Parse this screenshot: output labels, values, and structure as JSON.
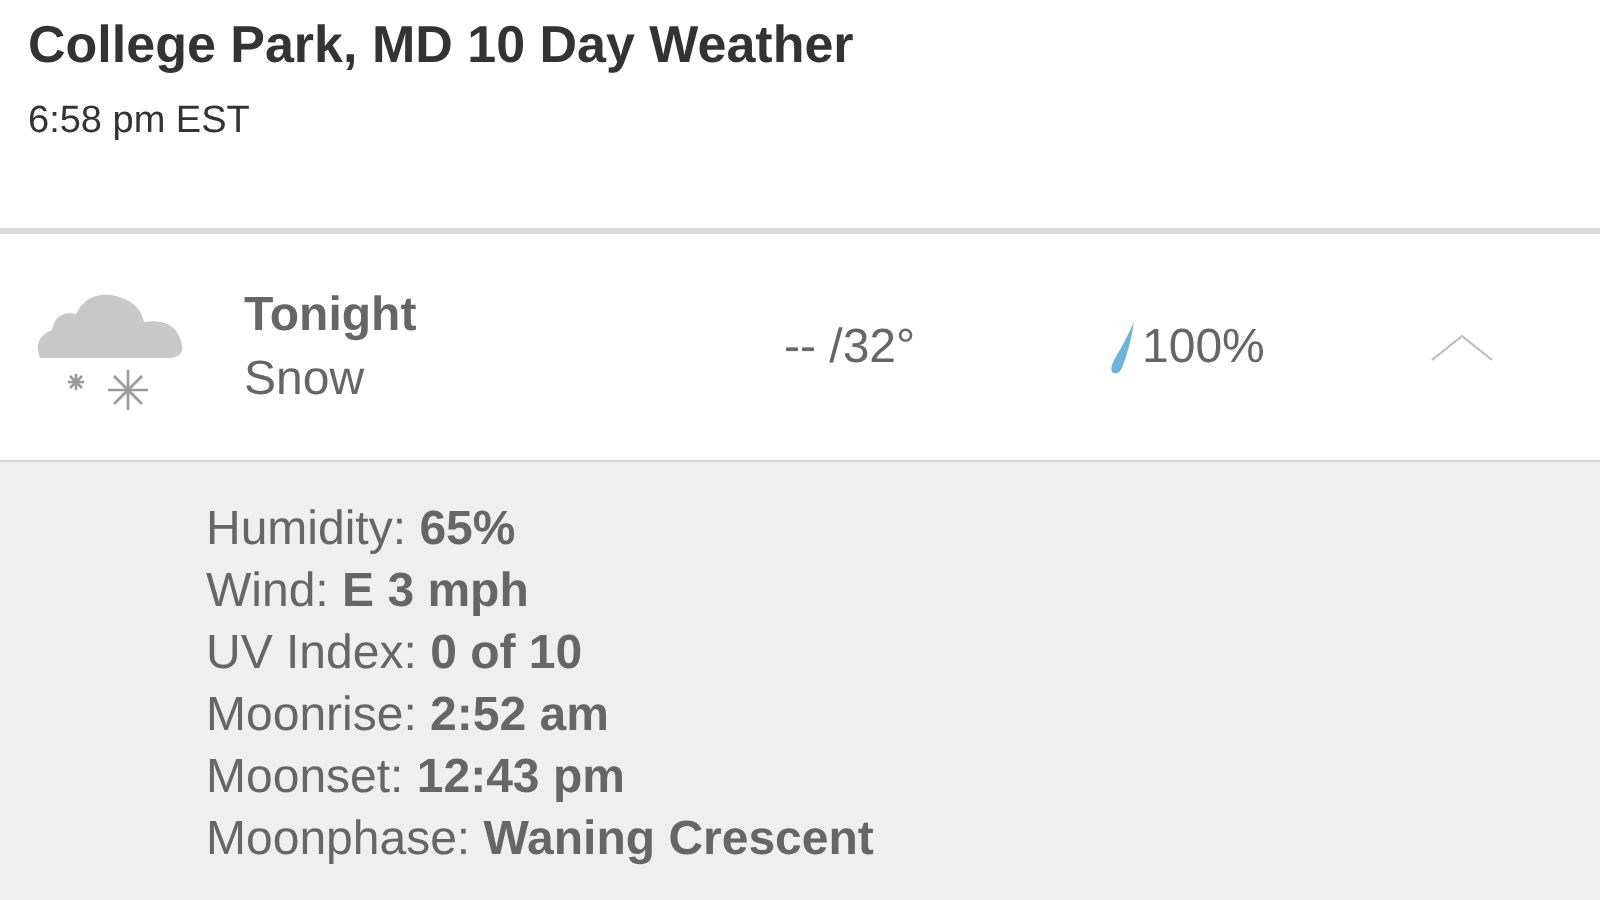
{
  "header": {
    "title": "College Park, MD 10 Day Weather",
    "time": "6:58 pm EST"
  },
  "day": {
    "name": "Tonight",
    "condition": "Snow",
    "temps": "-- /32°",
    "precip": "100%",
    "expanded": true
  },
  "details": [
    {
      "label": "Humidity:",
      "value": "65%"
    },
    {
      "label": "Wind:",
      "value": "E 3 mph"
    },
    {
      "label": "UV Index:",
      "value": "0 of 10"
    },
    {
      "label": "Moonrise:",
      "value": "2:52 am"
    },
    {
      "label": "Moonset:",
      "value": "12:43 pm"
    },
    {
      "label": "Moonphase:",
      "value": "Waning Crescent"
    }
  ]
}
